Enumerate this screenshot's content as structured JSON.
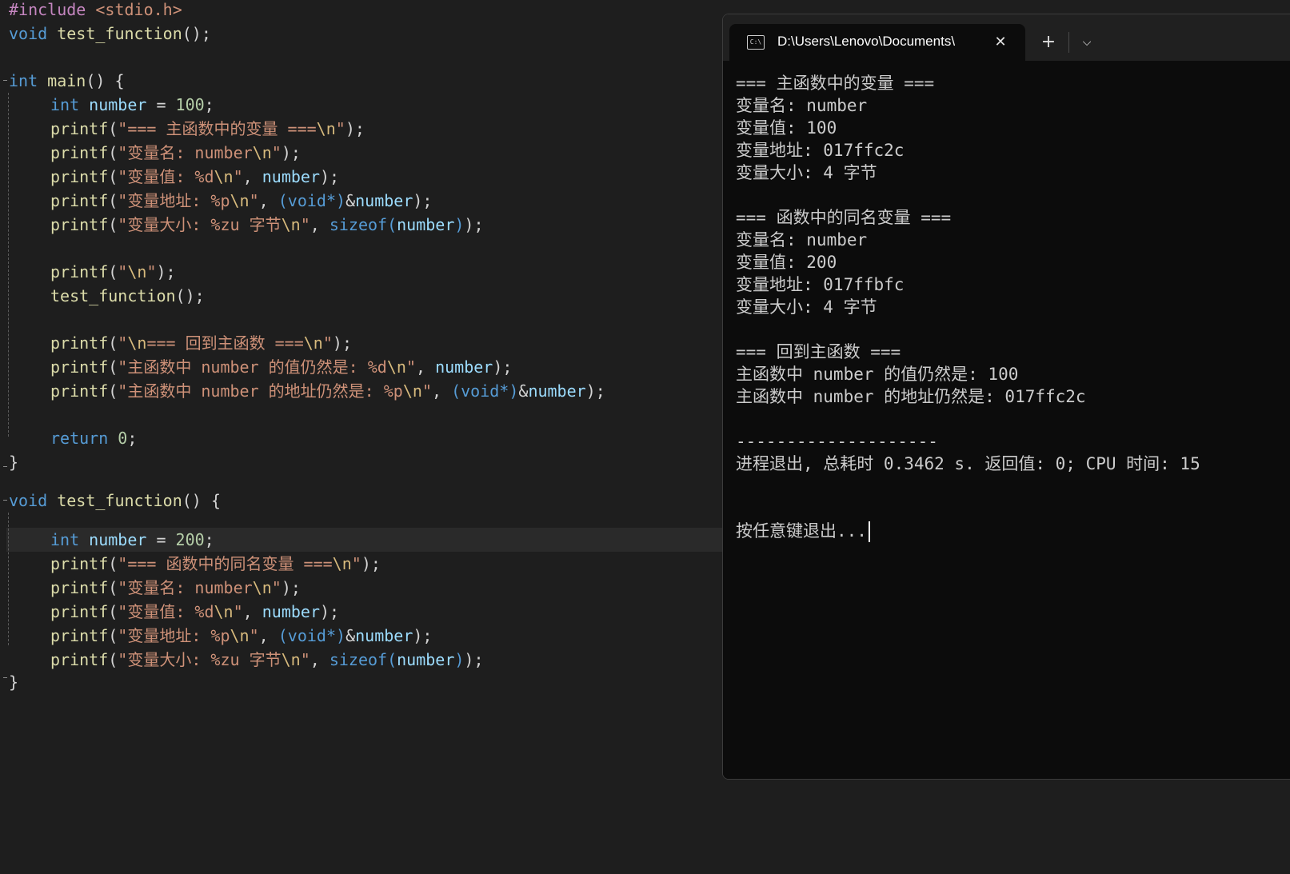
{
  "editor": {
    "code": {
      "l1": {
        "pre": "#include",
        "hdr": " <stdio.h>"
      },
      "l2": {
        "kw": "void",
        "fn": " test_function",
        "rest": "();"
      },
      "l4": {
        "kw": "int",
        "fn": " main",
        "rest": "() {"
      },
      "l5": {
        "kw": "int",
        "var": " number",
        "op": " = ",
        "num": "100",
        "end": ";"
      },
      "l6": {
        "fn": "printf",
        "p1": "(",
        "str": "\"=== 主函数中的变量 ===",
        "esc": "\\n",
        "strend": "\"",
        "p2": ");"
      },
      "l7": {
        "fn": "printf",
        "p1": "(",
        "str": "\"变量名: number",
        "esc": "\\n",
        "strend": "\"",
        "p2": ");"
      },
      "l8": {
        "fn": "printf",
        "p1": "(",
        "str": "\"变量值: %d",
        "esc": "\\n",
        "strend": "\"",
        "sep": ", ",
        "var": "number",
        "p2": ");"
      },
      "l9": {
        "fn": "printf",
        "p1": "(",
        "str": "\"变量地址: %p",
        "esc": "\\n",
        "strend": "\"",
        "sep": ", ",
        "cast_open": "(",
        "cast_kw": "void",
        "cast_close": "*)",
        "amp": "&",
        "var": "number",
        "p2": ");"
      },
      "l10": {
        "fn": "printf",
        "p1": "(",
        "str": "\"变量大小: %zu 字节",
        "esc": "\\n",
        "strend": "\"",
        "sep": ", ",
        "kw": "sizeof",
        "po": "(",
        "var": "number",
        "pc": ")",
        "p2": ");"
      },
      "l12": {
        "fn": "printf",
        "p1": "(",
        "str": "\"",
        "esc": "\\n",
        "strend": "\"",
        "p2": ");"
      },
      "l13": {
        "fn": "test_function",
        "rest": "();"
      },
      "l15": {
        "fn": "printf",
        "p1": "(",
        "str": "\"",
        "esc": "\\n",
        "str2": "=== 回到主函数 ===",
        "esc2": "\\n",
        "strend": "\"",
        "p2": ");"
      },
      "l16": {
        "fn": "printf",
        "p1": "(",
        "str": "\"主函数中 number 的值仍然是: %d",
        "esc": "\\n",
        "strend": "\"",
        "sep": ", ",
        "var": "number",
        "p2": ");"
      },
      "l17": {
        "fn": "printf",
        "p1": "(",
        "str": "\"主函数中 number 的地址仍然是: %p",
        "esc": "\\n",
        "strend": "\"",
        "sep": ", ",
        "cast_open": "(",
        "cast_kw": "void",
        "cast_close": "*)",
        "amp": "&",
        "var": "number",
        "p2": ");"
      },
      "l19": {
        "kw": "return",
        "num": " 0",
        "end": ";"
      },
      "l20": {
        "rest": "}"
      },
      "l22": {
        "kw": "void",
        "fn": " test_function",
        "rest": "() {"
      },
      "l23": {
        "kw": "int",
        "var": " number",
        "op": " = ",
        "num": "200",
        "end": ";"
      },
      "l24": {
        "fn": "printf",
        "p1": "(",
        "str": "\"=== 函数中的同名变量 ===",
        "esc": "\\n",
        "strend": "\"",
        "p2": ");"
      },
      "l25": {
        "fn": "printf",
        "p1": "(",
        "str": "\"变量名: number",
        "esc": "\\n",
        "strend": "\"",
        "p2": ");"
      },
      "l26": {
        "fn": "printf",
        "p1": "(",
        "str": "\"变量值: %d",
        "esc": "\\n",
        "strend": "\"",
        "sep": ", ",
        "var": "number",
        "p2": ");"
      },
      "l27": {
        "fn": "printf",
        "p1": "(",
        "str": "\"变量地址: %p",
        "esc": "\\n",
        "strend": "\"",
        "sep": ", ",
        "cast_open": "(",
        "cast_kw": "void",
        "cast_close": "*)",
        "amp": "&",
        "var": "number",
        "p2": ");"
      },
      "l28": {
        "fn": "printf",
        "p1": "(",
        "str": "\"变量大小: %zu 字节",
        "esc": "\\n",
        "strend": "\"",
        "sep": ", ",
        "kw": "sizeof",
        "po": "(",
        "var": "number",
        "pc": ")",
        "p2": ");"
      },
      "l29": {
        "rest": "}"
      }
    },
    "colors": {
      "background": "#1e1e1e",
      "keyword": "#569cd6",
      "string": "#ce9178",
      "function": "#dcdcaa",
      "variable": "#9cdcfe",
      "number": "#b5cea8",
      "preprocessor": "#c586c0"
    }
  },
  "terminal": {
    "tab": {
      "icon": "cmd-icon",
      "icon_text": "C:\\",
      "title": "D:\\Users\\Lenovo\\Documents\\",
      "close": "✕"
    },
    "new_tab": "+",
    "dropdown": "⌵",
    "output": [
      "=== 主函数中的变量 ===",
      "变量名: number",
      "变量值: 100",
      "变量地址: 017ffc2c",
      "变量大小: 4 字节",
      "",
      "=== 函数中的同名变量 ===",
      "变量名: number",
      "变量值: 200",
      "变量地址: 017ffbfc",
      "变量大小: 4 字节",
      "",
      "=== 回到主函数 ===",
      "主函数中 number 的值仍然是: 100",
      "主函数中 number 的地址仍然是: 017ffc2c",
      "",
      "--------------------",
      "进程退出, 总耗时 0.3462 s. 返回值: 0; CPU 时间: 15",
      "",
      "",
      "按任意键退出..."
    ],
    "colors": {
      "background": "#0c0c0c",
      "text": "#cccccc",
      "titlebar": "#202020"
    }
  }
}
